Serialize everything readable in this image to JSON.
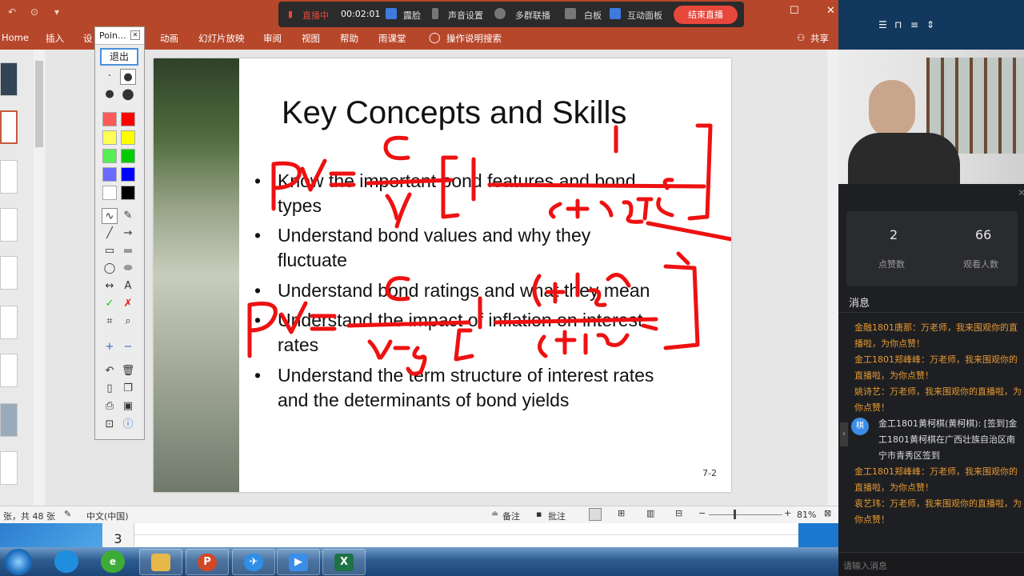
{
  "ribbon": {
    "tabs": [
      "Home",
      "插入",
      "设",
      "动画",
      "幻灯片放映",
      "审阅",
      "视图",
      "帮助",
      "雨课堂",
      "操作说明搜索"
    ],
    "share": "共享"
  },
  "live_bar": {
    "status": "直播中",
    "timer": "00:02:01",
    "items": [
      "露脸",
      "声音设置",
      "多群联播",
      "白板",
      "互动面板"
    ],
    "end_button": "结束直播"
  },
  "pointer_tool": {
    "title": "Poin...",
    "exit_label": "退出",
    "colors": [
      "#ff5a5a",
      "#ff0000",
      "#ffff55",
      "#ffff00",
      "#55ee55",
      "#00cc00",
      "#6a6aff",
      "#0000ff",
      "#ffffff",
      "#000000"
    ]
  },
  "slide": {
    "title": "Key Concepts and Skills",
    "bullets": [
      [
        "Know the important bond features and bond",
        "types"
      ],
      [
        "Understand bond values and why they",
        "fluctuate"
      ],
      [
        "Understand bond ratings and what they mean"
      ],
      [
        "Understand the impact of inflation on interest",
        "rates"
      ],
      [
        "Understand the term structure of interest rates",
        "and the determinants of bond yields"
      ]
    ],
    "page_number": "7-2"
  },
  "status_bar": {
    "slide_count": "张，共 48 张",
    "language": "中文(中国)",
    "notes": "备注",
    "comments": "批注",
    "zoom": "81%"
  },
  "excel_row": "3",
  "right_panel": {
    "likes": "2",
    "likes_label": "点赞数",
    "viewers": "66",
    "viewers_label": "观看人数",
    "messages_title": "消息",
    "messages": [
      {
        "text": "金融1801唐那：万老师，我来围观你的直播啦，为你点赞！",
        "style": "orange"
      },
      {
        "text": "金工1801郑峰峰：万老师，我来围观你的直播啦，为你点赞！",
        "style": "orange"
      },
      {
        "text": "姚诗艺：万老师，我来围观你的直播啦，为你点赞！",
        "style": "orange"
      },
      {
        "text": "金工1801黄柯棋(黄柯棋): [签到]金工1801黄柯棋在广西壮族自治区南宁市青秀区签到",
        "style": "white"
      },
      {
        "text": "金工1801郑峰峰：万老师，我来围观你的直播啦，为你点赞！",
        "style": "orange"
      },
      {
        "text": "袁艺玮：万老师，我来围观你的直播啦，为你点赞！",
        "style": "orange"
      }
    ],
    "input_placeholder": "请输入消息",
    "avatar_text": "棋"
  }
}
